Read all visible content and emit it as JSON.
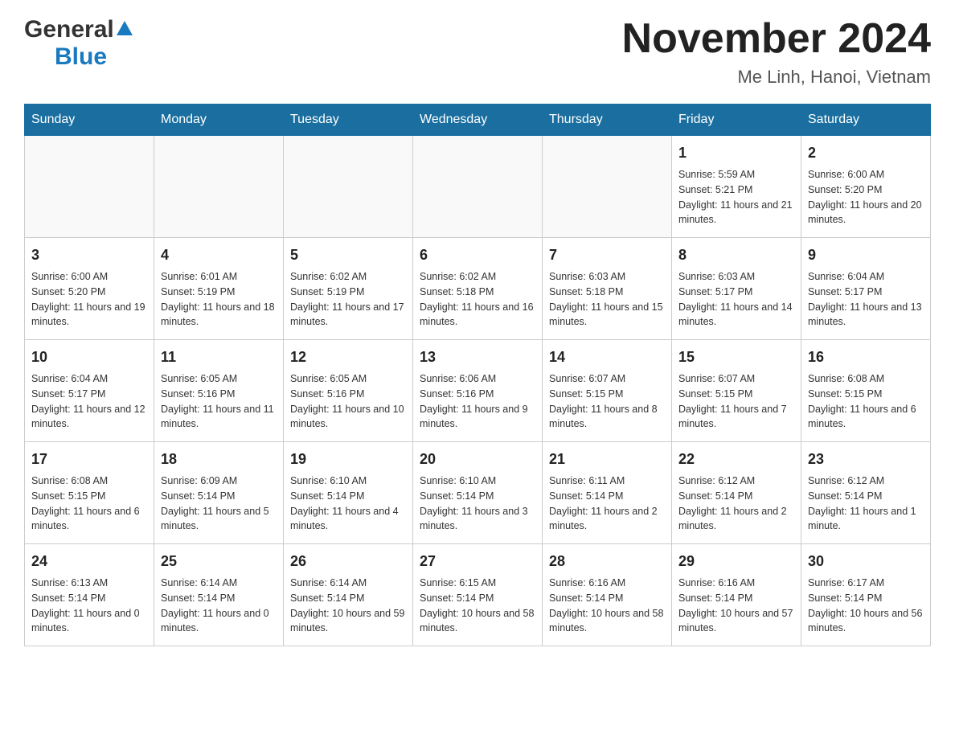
{
  "header": {
    "logo_general": "General",
    "logo_blue": "Blue",
    "month_title": "November 2024",
    "location": "Me Linh, Hanoi, Vietnam"
  },
  "days_of_week": [
    "Sunday",
    "Monday",
    "Tuesday",
    "Wednesday",
    "Thursday",
    "Friday",
    "Saturday"
  ],
  "weeks": [
    [
      {
        "day": "",
        "sunrise": "",
        "sunset": "",
        "daylight": ""
      },
      {
        "day": "",
        "sunrise": "",
        "sunset": "",
        "daylight": ""
      },
      {
        "day": "",
        "sunrise": "",
        "sunset": "",
        "daylight": ""
      },
      {
        "day": "",
        "sunrise": "",
        "sunset": "",
        "daylight": ""
      },
      {
        "day": "",
        "sunrise": "",
        "sunset": "",
        "daylight": ""
      },
      {
        "day": "1",
        "sunrise": "Sunrise: 5:59 AM",
        "sunset": "Sunset: 5:21 PM",
        "daylight": "Daylight: 11 hours and 21 minutes."
      },
      {
        "day": "2",
        "sunrise": "Sunrise: 6:00 AM",
        "sunset": "Sunset: 5:20 PM",
        "daylight": "Daylight: 11 hours and 20 minutes."
      }
    ],
    [
      {
        "day": "3",
        "sunrise": "Sunrise: 6:00 AM",
        "sunset": "Sunset: 5:20 PM",
        "daylight": "Daylight: 11 hours and 19 minutes."
      },
      {
        "day": "4",
        "sunrise": "Sunrise: 6:01 AM",
        "sunset": "Sunset: 5:19 PM",
        "daylight": "Daylight: 11 hours and 18 minutes."
      },
      {
        "day": "5",
        "sunrise": "Sunrise: 6:02 AM",
        "sunset": "Sunset: 5:19 PM",
        "daylight": "Daylight: 11 hours and 17 minutes."
      },
      {
        "day": "6",
        "sunrise": "Sunrise: 6:02 AM",
        "sunset": "Sunset: 5:18 PM",
        "daylight": "Daylight: 11 hours and 16 minutes."
      },
      {
        "day": "7",
        "sunrise": "Sunrise: 6:03 AM",
        "sunset": "Sunset: 5:18 PM",
        "daylight": "Daylight: 11 hours and 15 minutes."
      },
      {
        "day": "8",
        "sunrise": "Sunrise: 6:03 AM",
        "sunset": "Sunset: 5:17 PM",
        "daylight": "Daylight: 11 hours and 14 minutes."
      },
      {
        "day": "9",
        "sunrise": "Sunrise: 6:04 AM",
        "sunset": "Sunset: 5:17 PM",
        "daylight": "Daylight: 11 hours and 13 minutes."
      }
    ],
    [
      {
        "day": "10",
        "sunrise": "Sunrise: 6:04 AM",
        "sunset": "Sunset: 5:17 PM",
        "daylight": "Daylight: 11 hours and 12 minutes."
      },
      {
        "day": "11",
        "sunrise": "Sunrise: 6:05 AM",
        "sunset": "Sunset: 5:16 PM",
        "daylight": "Daylight: 11 hours and 11 minutes."
      },
      {
        "day": "12",
        "sunrise": "Sunrise: 6:05 AM",
        "sunset": "Sunset: 5:16 PM",
        "daylight": "Daylight: 11 hours and 10 minutes."
      },
      {
        "day": "13",
        "sunrise": "Sunrise: 6:06 AM",
        "sunset": "Sunset: 5:16 PM",
        "daylight": "Daylight: 11 hours and 9 minutes."
      },
      {
        "day": "14",
        "sunrise": "Sunrise: 6:07 AM",
        "sunset": "Sunset: 5:15 PM",
        "daylight": "Daylight: 11 hours and 8 minutes."
      },
      {
        "day": "15",
        "sunrise": "Sunrise: 6:07 AM",
        "sunset": "Sunset: 5:15 PM",
        "daylight": "Daylight: 11 hours and 7 minutes."
      },
      {
        "day": "16",
        "sunrise": "Sunrise: 6:08 AM",
        "sunset": "Sunset: 5:15 PM",
        "daylight": "Daylight: 11 hours and 6 minutes."
      }
    ],
    [
      {
        "day": "17",
        "sunrise": "Sunrise: 6:08 AM",
        "sunset": "Sunset: 5:15 PM",
        "daylight": "Daylight: 11 hours and 6 minutes."
      },
      {
        "day": "18",
        "sunrise": "Sunrise: 6:09 AM",
        "sunset": "Sunset: 5:14 PM",
        "daylight": "Daylight: 11 hours and 5 minutes."
      },
      {
        "day": "19",
        "sunrise": "Sunrise: 6:10 AM",
        "sunset": "Sunset: 5:14 PM",
        "daylight": "Daylight: 11 hours and 4 minutes."
      },
      {
        "day": "20",
        "sunrise": "Sunrise: 6:10 AM",
        "sunset": "Sunset: 5:14 PM",
        "daylight": "Daylight: 11 hours and 3 minutes."
      },
      {
        "day": "21",
        "sunrise": "Sunrise: 6:11 AM",
        "sunset": "Sunset: 5:14 PM",
        "daylight": "Daylight: 11 hours and 2 minutes."
      },
      {
        "day": "22",
        "sunrise": "Sunrise: 6:12 AM",
        "sunset": "Sunset: 5:14 PM",
        "daylight": "Daylight: 11 hours and 2 minutes."
      },
      {
        "day": "23",
        "sunrise": "Sunrise: 6:12 AM",
        "sunset": "Sunset: 5:14 PM",
        "daylight": "Daylight: 11 hours and 1 minute."
      }
    ],
    [
      {
        "day": "24",
        "sunrise": "Sunrise: 6:13 AM",
        "sunset": "Sunset: 5:14 PM",
        "daylight": "Daylight: 11 hours and 0 minutes."
      },
      {
        "day": "25",
        "sunrise": "Sunrise: 6:14 AM",
        "sunset": "Sunset: 5:14 PM",
        "daylight": "Daylight: 11 hours and 0 minutes."
      },
      {
        "day": "26",
        "sunrise": "Sunrise: 6:14 AM",
        "sunset": "Sunset: 5:14 PM",
        "daylight": "Daylight: 10 hours and 59 minutes."
      },
      {
        "day": "27",
        "sunrise": "Sunrise: 6:15 AM",
        "sunset": "Sunset: 5:14 PM",
        "daylight": "Daylight: 10 hours and 58 minutes."
      },
      {
        "day": "28",
        "sunrise": "Sunrise: 6:16 AM",
        "sunset": "Sunset: 5:14 PM",
        "daylight": "Daylight: 10 hours and 58 minutes."
      },
      {
        "day": "29",
        "sunrise": "Sunrise: 6:16 AM",
        "sunset": "Sunset: 5:14 PM",
        "daylight": "Daylight: 10 hours and 57 minutes."
      },
      {
        "day": "30",
        "sunrise": "Sunrise: 6:17 AM",
        "sunset": "Sunset: 5:14 PM",
        "daylight": "Daylight: 10 hours and 56 minutes."
      }
    ]
  ]
}
